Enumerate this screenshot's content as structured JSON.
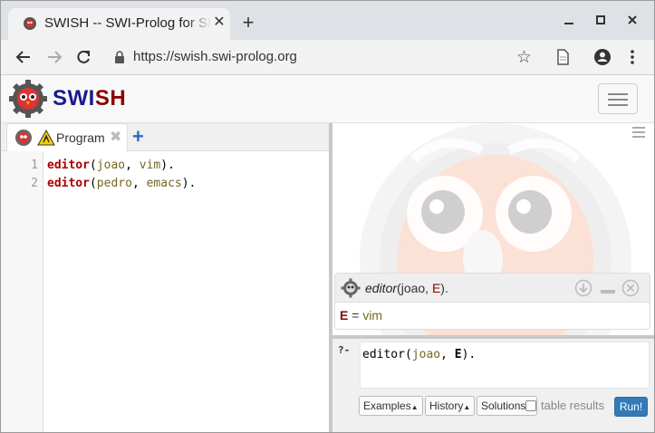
{
  "browser": {
    "tab_title": "SWISH -- SWI-Prolog for SHaring",
    "url": "https://swish.swi-prolog.org",
    "new_tab_label": "+",
    "tab_close_label": "✕"
  },
  "app": {
    "brand_part1": "SWI",
    "brand_part2": "SH",
    "colors": {
      "brand_blue": "#1a1a8c",
      "brand_red": "#8b0000",
      "run_button": "#337ab7"
    }
  },
  "editor": {
    "tab_label": "Program",
    "tab_close": "✖",
    "add_tab": "+",
    "lines": [
      {
        "num": "1",
        "pred": "editor",
        "open": "(",
        "arg1": "joao",
        "sep": ", ",
        "arg2": "vim",
        "close": ")."
      },
      {
        "num": "2",
        "pred": "editor",
        "open": "(",
        "arg1": "pedro",
        "sep": ", ",
        "arg2": "emacs",
        "close": ")."
      }
    ]
  },
  "answer": {
    "query_pred": "editor",
    "query_open": "(",
    "query_arg": "joao",
    "query_sep": ", ",
    "query_var": "E",
    "query_close": ").",
    "binding_var": "E",
    "binding_eq": " = ",
    "binding_value": "vim"
  },
  "query": {
    "prompt": "?-",
    "pred": "editor",
    "open": "(",
    "arg": "joao",
    "sep": ", ",
    "var": "E",
    "close": ").",
    "examples_label": "Examples",
    "history_label": "History",
    "solutions_label": "Solutions",
    "caret": "▲",
    "table_results_label": "table results",
    "run_label": "Run!"
  }
}
